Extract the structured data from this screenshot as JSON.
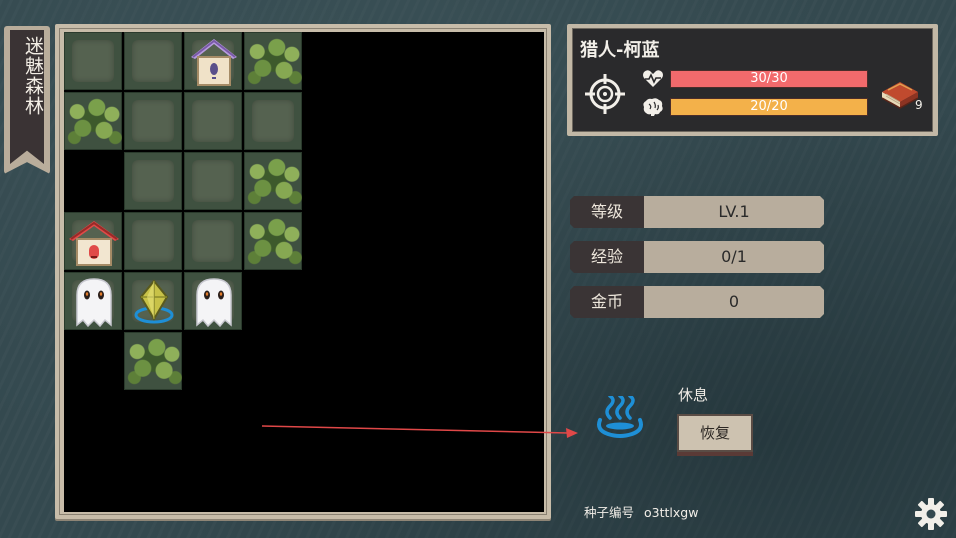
{
  "area": {
    "name": "迷魅森林"
  },
  "board": {
    "tiles": [
      {
        "c": 0,
        "r": 0,
        "t": "ground"
      },
      {
        "c": 1,
        "r": 0,
        "t": "ground"
      },
      {
        "c": 2,
        "r": 0,
        "t": "ground",
        "s": "birdhouse"
      },
      {
        "c": 3,
        "r": 0,
        "t": "bush"
      },
      {
        "c": 0,
        "r": 1,
        "t": "bush"
      },
      {
        "c": 1,
        "r": 1,
        "t": "ground"
      },
      {
        "c": 2,
        "r": 1,
        "t": "ground"
      },
      {
        "c": 3,
        "r": 1,
        "t": "ground"
      },
      {
        "c": 1,
        "r": 2,
        "t": "ground"
      },
      {
        "c": 2,
        "r": 2,
        "t": "ground"
      },
      {
        "c": 3,
        "r": 2,
        "t": "bush"
      },
      {
        "c": 0,
        "r": 3,
        "t": "ground",
        "s": "red-house"
      },
      {
        "c": 1,
        "r": 3,
        "t": "ground"
      },
      {
        "c": 2,
        "r": 3,
        "t": "ground"
      },
      {
        "c": 3,
        "r": 3,
        "t": "bush"
      },
      {
        "c": 0,
        "r": 4,
        "t": "ground",
        "s": "ghost"
      },
      {
        "c": 1,
        "r": 4,
        "t": "ground",
        "s": "crystal"
      },
      {
        "c": 2,
        "r": 4,
        "t": "ground",
        "s": "ghost"
      },
      {
        "c": 1,
        "r": 5,
        "t": "bush"
      }
    ]
  },
  "player": {
    "name": "猎人-柯蓝",
    "hp_text": "30/30",
    "hp_fraction": 1.0,
    "mp_text": "20/20",
    "mp_fraction": 1.0,
    "class_icon": "crosshair-icon",
    "hp_icon": "heartbeat-icon",
    "mp_icon": "brain-icon",
    "book_icon": "book-icon",
    "book_count": "9"
  },
  "stats": [
    {
      "label": "等级",
      "value": "LV.1"
    },
    {
      "label": "经验",
      "value": "0/1"
    },
    {
      "label": "金币",
      "value": "0"
    }
  ],
  "action": {
    "title": "休息",
    "button_label": "恢复",
    "icon": "hot-spring-icon"
  },
  "seed": {
    "label": "种子编号",
    "value": "o3ttlxgw"
  },
  "colors": {
    "hp": "#f26a6c",
    "mp": "#f3b14a",
    "accent_blue": "#1e8fd6",
    "annotation_arrow": "#e04848"
  }
}
